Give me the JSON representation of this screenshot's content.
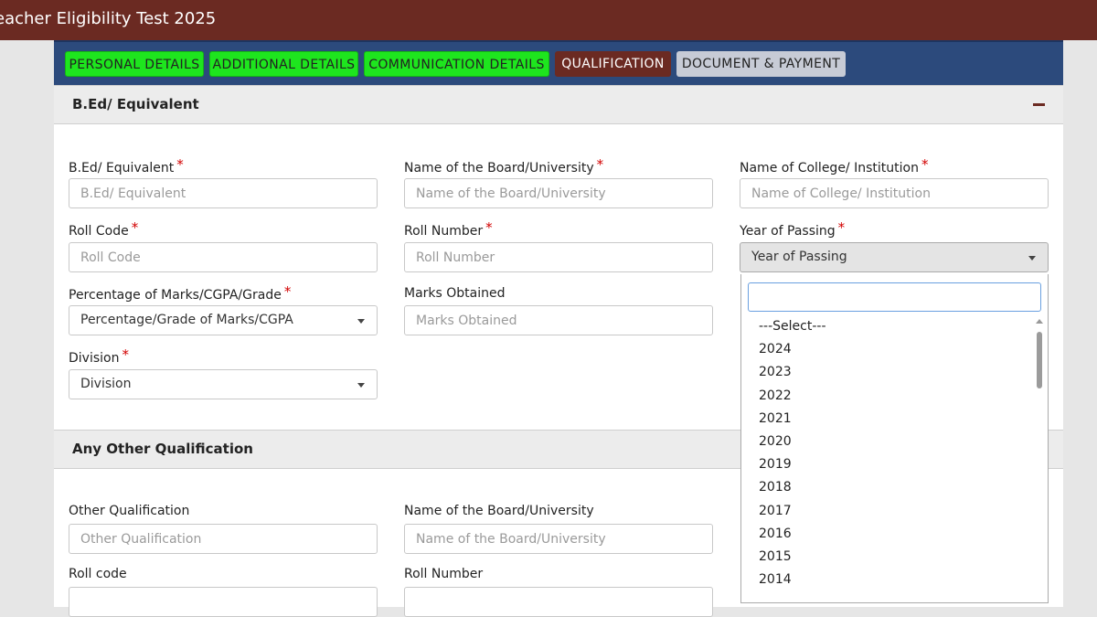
{
  "header": {
    "title": "eacher Eligibility Test 2025"
  },
  "tabs": [
    {
      "label": "PERSONAL DETAILS",
      "state": "done"
    },
    {
      "label": "ADDITIONAL DETAILS",
      "state": "done"
    },
    {
      "label": "COMMUNICATION DETAILS",
      "state": "done"
    },
    {
      "label": "QUALIFICATION",
      "state": "active"
    },
    {
      "label": "DOCUMENT & PAYMENT",
      "state": "pending"
    }
  ],
  "bed_section": {
    "title": "B.Ed/ Equivalent",
    "fields": {
      "bed": {
        "label": "B.Ed/ Equivalent",
        "placeholder": "B.Ed/ Equivalent",
        "required": "*"
      },
      "board": {
        "label": "Name of the Board/University",
        "placeholder": "Name of the Board/University",
        "required": "*"
      },
      "college": {
        "label": "Name of College/ Institution",
        "placeholder": "Name of College/ Institution",
        "required": "*"
      },
      "roll_code": {
        "label": "Roll Code",
        "placeholder": "Roll Code",
        "required": "*"
      },
      "roll_number": {
        "label": "Roll Number",
        "placeholder": "Roll Number",
        "required": "*"
      },
      "year": {
        "label": "Year of Passing",
        "value": "Year of Passing",
        "required": "*"
      },
      "percentage": {
        "label": "Percentage of Marks/CGPA/Grade",
        "value": "Percentage/Grade of Marks/CGPA",
        "required": "*"
      },
      "marks": {
        "label": "Marks Obtained",
        "placeholder": "Marks Obtained"
      },
      "division": {
        "label": "Division",
        "value": "Division",
        "required": "*"
      }
    }
  },
  "other_section": {
    "title": "Any Other Qualification",
    "fields": {
      "other_qual": {
        "label": "Other Qualification",
        "placeholder": "Other Qualification"
      },
      "board": {
        "label": "Name of the Board/University",
        "placeholder": "Name of the Board/University"
      },
      "roll_code": {
        "label": "Roll code"
      },
      "roll_number": {
        "label": "Roll Number"
      }
    }
  },
  "year_dropdown": {
    "options": [
      "---Select---",
      "2024",
      "2023",
      "2022",
      "2021",
      "2020",
      "2019",
      "2018",
      "2017",
      "2016",
      "2015",
      "2014"
    ]
  },
  "colors": {
    "topbar": "#6b2a22",
    "tab_done": "#1ee51e",
    "tab_active": "#6b2a22",
    "tab_pending": "#c7cbd6",
    "tabbar": "#2c4a7c",
    "required": "#d20000"
  }
}
